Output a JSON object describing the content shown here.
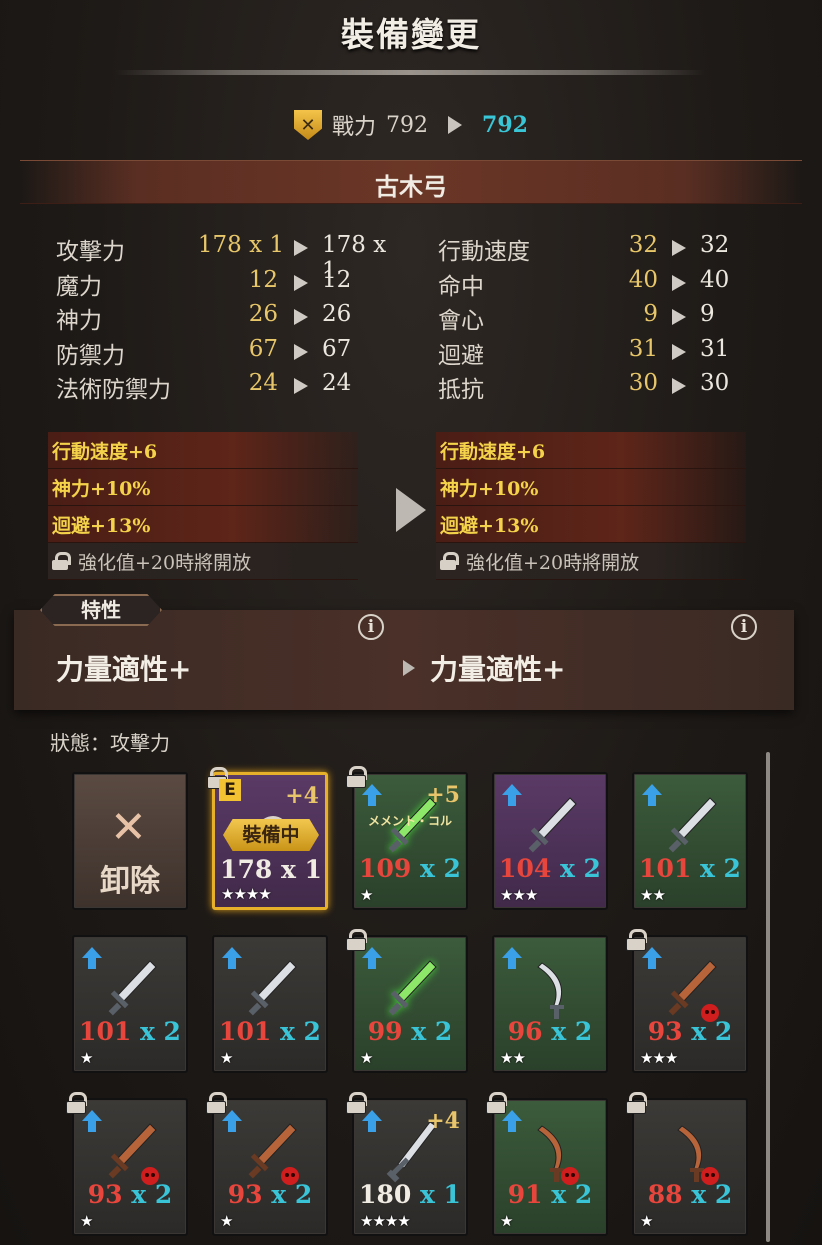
{
  "header": {
    "title": "裝備變更"
  },
  "power": {
    "label": "戰力",
    "old": "792",
    "new": "792",
    "icon": "crossed-swords-shield-icon"
  },
  "item": {
    "name": "古木弓"
  },
  "stats_left": [
    {
      "name": "攻擊力",
      "old": "178 x 1",
      "new": "178 x 1"
    },
    {
      "name": "魔力",
      "old": "12",
      "new": "12"
    },
    {
      "name": "神力",
      "old": "26",
      "new": "26"
    },
    {
      "name": "防禦力",
      "old": "67",
      "new": "67"
    },
    {
      "name": "法術防禦力",
      "old": "24",
      "new": "24"
    }
  ],
  "stats_right": [
    {
      "name": "行動速度",
      "old": "32",
      "new": "32"
    },
    {
      "name": "命中",
      "old": "40",
      "new": "40"
    },
    {
      "name": "會心",
      "old": "9",
      "new": "9"
    },
    {
      "name": "迴避",
      "old": "31",
      "new": "31"
    },
    {
      "name": "抵抗",
      "old": "30",
      "new": "30"
    }
  ],
  "substats_old": [
    "行動速度+6",
    "神力+10%",
    "迴避+13%"
  ],
  "substats_new": [
    "行動速度+6",
    "神力+10%",
    "迴避+13%"
  ],
  "locked_text": "強化值+20時將開放",
  "traits": {
    "tab": "特性",
    "old": "力量適性+",
    "new": "力量適性+",
    "info": "i"
  },
  "status": {
    "label": "狀態：攻擊力"
  },
  "unequip": {
    "label": "卸除",
    "icon": "x-icon"
  },
  "equipped_badge": "裝備中",
  "equipped_marker": "E",
  "cards": [
    {
      "bg": "purple",
      "locked": true,
      "upgrade": false,
      "plus": "+4",
      "value": "178",
      "mult": "x 1",
      "stars": "★★★★",
      "weapon": "bow",
      "equipped": true
    },
    {
      "bg": "green",
      "locked": true,
      "upgrade": true,
      "plus": "+5",
      "caption": "メメント・コル",
      "value": "109",
      "mult": "x 2",
      "stars": "★",
      "weapon": "sword-green"
    },
    {
      "bg": "purple",
      "locked": false,
      "upgrade": true,
      "value": "104",
      "mult": "x 2",
      "stars": "★★★",
      "weapon": "sword"
    },
    {
      "bg": "green",
      "locked": false,
      "upgrade": true,
      "value": "101",
      "mult": "x 2",
      "stars": "★★",
      "weapon": "sword"
    },
    {
      "bg": "gray",
      "locked": false,
      "upgrade": true,
      "value": "101",
      "mult": "x 2",
      "stars": "★",
      "weapon": "sword"
    },
    {
      "bg": "gray",
      "locked": false,
      "upgrade": true,
      "value": "101",
      "mult": "x 2",
      "stars": "★",
      "weapon": "sword"
    },
    {
      "bg": "green",
      "locked": true,
      "upgrade": true,
      "value": "99",
      "mult": "x 2",
      "stars": "★",
      "weapon": "sword-green"
    },
    {
      "bg": "green",
      "locked": false,
      "upgrade": true,
      "value": "96",
      "mult": "x 2",
      "stars": "★★",
      "weapon": "scimitar"
    },
    {
      "bg": "gray",
      "locked": true,
      "upgrade": true,
      "value": "93",
      "mult": "x 2",
      "stars": "★★★",
      "weapon": "rusty-sword-skull"
    },
    {
      "bg": "gray",
      "locked": true,
      "upgrade": true,
      "value": "93",
      "mult": "x 2",
      "stars": "★",
      "weapon": "rusty-sword-skull"
    },
    {
      "bg": "gray",
      "locked": true,
      "upgrade": true,
      "value": "93",
      "mult": "x 2",
      "stars": "★",
      "weapon": "rusty-sword-skull"
    },
    {
      "bg": "gray",
      "locked": true,
      "upgrade": true,
      "plus": "+4",
      "value": "180",
      "mult": "x 1",
      "stars": "★★★★",
      "weapon": "greatsword",
      "white": true
    },
    {
      "bg": "green",
      "locked": true,
      "upgrade": true,
      "value": "91",
      "mult": "x 2",
      "stars": "★",
      "weapon": "rusty-scimitar-skull"
    },
    {
      "bg": "gray",
      "locked": true,
      "upgrade": false,
      "value": "88",
      "mult": "x 2",
      "stars": "★",
      "weapon": "rusty-scimitar-skull"
    }
  ]
}
